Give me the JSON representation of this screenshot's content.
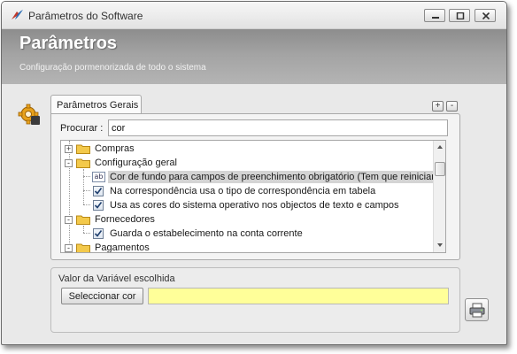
{
  "window": {
    "title": "Parâmetros do Software"
  },
  "banner": {
    "title": "Parâmetros",
    "subtitle": "Configuração pormenorizada de todo o sistema"
  },
  "tabs": [
    {
      "label": "Parâmetros Gerais",
      "active": true
    }
  ],
  "panel": {
    "expand_label": "+",
    "collapse_label": "-"
  },
  "search": {
    "label": "Procurar :",
    "value": "cor"
  },
  "tree": {
    "items": [
      {
        "label": "Compras",
        "type": "folder",
        "expander": "+"
      },
      {
        "label": "Configuração geral",
        "type": "folder",
        "expander": "-"
      },
      {
        "label": "Cor de fundo para campos de preenchimento obrigatório (Tem que reiniciar a",
        "type": "text-param",
        "selected": true
      },
      {
        "label": "Na correspondência usa o tipo de correspondência em tabela",
        "type": "checkbox",
        "checked": true
      },
      {
        "label": "Usa as cores do sistema operativo nos objectos de texto e campos",
        "type": "checkbox",
        "checked": true
      },
      {
        "label": "Fornecedores",
        "type": "folder",
        "expander": "-"
      },
      {
        "label": "Guarda o estabelecimento na conta corrente",
        "type": "checkbox",
        "checked": true
      },
      {
        "label": "Pagamentos",
        "type": "folder",
        "expander": "-"
      }
    ]
  },
  "value_group": {
    "label": "Valor da Variável escolhida",
    "select_button": "Seleccionar cor",
    "selected_color": "#ffff99"
  },
  "icons": {
    "app": "app-logo-icon",
    "gear": "gear-icon",
    "folder": "folder-icon",
    "print": "printer-icon"
  }
}
